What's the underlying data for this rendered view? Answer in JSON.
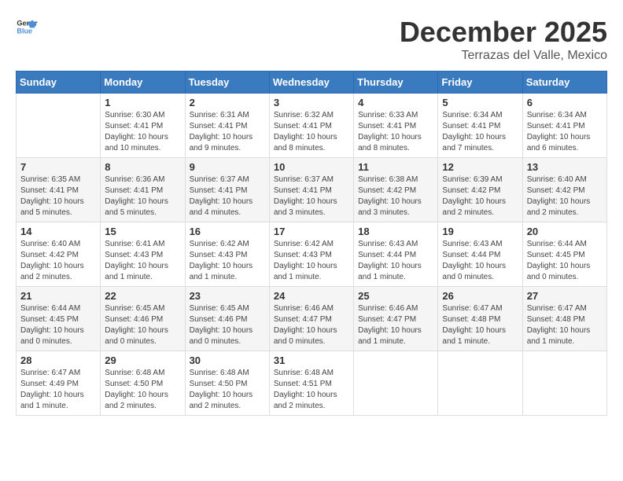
{
  "logo": {
    "text_general": "General",
    "text_blue": "Blue"
  },
  "title": {
    "month": "December 2025",
    "location": "Terrazas del Valle, Mexico"
  },
  "weekdays": [
    "Sunday",
    "Monday",
    "Tuesday",
    "Wednesday",
    "Thursday",
    "Friday",
    "Saturday"
  ],
  "weeks": [
    [
      {
        "day": "",
        "info": ""
      },
      {
        "day": "1",
        "info": "Sunrise: 6:30 AM\nSunset: 4:41 PM\nDaylight: 10 hours\nand 10 minutes."
      },
      {
        "day": "2",
        "info": "Sunrise: 6:31 AM\nSunset: 4:41 PM\nDaylight: 10 hours\nand 9 minutes."
      },
      {
        "day": "3",
        "info": "Sunrise: 6:32 AM\nSunset: 4:41 PM\nDaylight: 10 hours\nand 8 minutes."
      },
      {
        "day": "4",
        "info": "Sunrise: 6:33 AM\nSunset: 4:41 PM\nDaylight: 10 hours\nand 8 minutes."
      },
      {
        "day": "5",
        "info": "Sunrise: 6:34 AM\nSunset: 4:41 PM\nDaylight: 10 hours\nand 7 minutes."
      },
      {
        "day": "6",
        "info": "Sunrise: 6:34 AM\nSunset: 4:41 PM\nDaylight: 10 hours\nand 6 minutes."
      }
    ],
    [
      {
        "day": "7",
        "info": "Sunrise: 6:35 AM\nSunset: 4:41 PM\nDaylight: 10 hours\nand 5 minutes."
      },
      {
        "day": "8",
        "info": "Sunrise: 6:36 AM\nSunset: 4:41 PM\nDaylight: 10 hours\nand 5 minutes."
      },
      {
        "day": "9",
        "info": "Sunrise: 6:37 AM\nSunset: 4:41 PM\nDaylight: 10 hours\nand 4 minutes."
      },
      {
        "day": "10",
        "info": "Sunrise: 6:37 AM\nSunset: 4:41 PM\nDaylight: 10 hours\nand 3 minutes."
      },
      {
        "day": "11",
        "info": "Sunrise: 6:38 AM\nSunset: 4:42 PM\nDaylight: 10 hours\nand 3 minutes."
      },
      {
        "day": "12",
        "info": "Sunrise: 6:39 AM\nSunset: 4:42 PM\nDaylight: 10 hours\nand 2 minutes."
      },
      {
        "day": "13",
        "info": "Sunrise: 6:40 AM\nSunset: 4:42 PM\nDaylight: 10 hours\nand 2 minutes."
      }
    ],
    [
      {
        "day": "14",
        "info": "Sunrise: 6:40 AM\nSunset: 4:42 PM\nDaylight: 10 hours\nand 2 minutes."
      },
      {
        "day": "15",
        "info": "Sunrise: 6:41 AM\nSunset: 4:43 PM\nDaylight: 10 hours\nand 1 minute."
      },
      {
        "day": "16",
        "info": "Sunrise: 6:42 AM\nSunset: 4:43 PM\nDaylight: 10 hours\nand 1 minute."
      },
      {
        "day": "17",
        "info": "Sunrise: 6:42 AM\nSunset: 4:43 PM\nDaylight: 10 hours\nand 1 minute."
      },
      {
        "day": "18",
        "info": "Sunrise: 6:43 AM\nSunset: 4:44 PM\nDaylight: 10 hours\nand 1 minute."
      },
      {
        "day": "19",
        "info": "Sunrise: 6:43 AM\nSunset: 4:44 PM\nDaylight: 10 hours\nand 0 minutes."
      },
      {
        "day": "20",
        "info": "Sunrise: 6:44 AM\nSunset: 4:45 PM\nDaylight: 10 hours\nand 0 minutes."
      }
    ],
    [
      {
        "day": "21",
        "info": "Sunrise: 6:44 AM\nSunset: 4:45 PM\nDaylight: 10 hours\nand 0 minutes."
      },
      {
        "day": "22",
        "info": "Sunrise: 6:45 AM\nSunset: 4:46 PM\nDaylight: 10 hours\nand 0 minutes."
      },
      {
        "day": "23",
        "info": "Sunrise: 6:45 AM\nSunset: 4:46 PM\nDaylight: 10 hours\nand 0 minutes."
      },
      {
        "day": "24",
        "info": "Sunrise: 6:46 AM\nSunset: 4:47 PM\nDaylight: 10 hours\nand 0 minutes."
      },
      {
        "day": "25",
        "info": "Sunrise: 6:46 AM\nSunset: 4:47 PM\nDaylight: 10 hours\nand 1 minute."
      },
      {
        "day": "26",
        "info": "Sunrise: 6:47 AM\nSunset: 4:48 PM\nDaylight: 10 hours\nand 1 minute."
      },
      {
        "day": "27",
        "info": "Sunrise: 6:47 AM\nSunset: 4:48 PM\nDaylight: 10 hours\nand 1 minute."
      }
    ],
    [
      {
        "day": "28",
        "info": "Sunrise: 6:47 AM\nSunset: 4:49 PM\nDaylight: 10 hours\nand 1 minute."
      },
      {
        "day": "29",
        "info": "Sunrise: 6:48 AM\nSunset: 4:50 PM\nDaylight: 10 hours\nand 2 minutes."
      },
      {
        "day": "30",
        "info": "Sunrise: 6:48 AM\nSunset: 4:50 PM\nDaylight: 10 hours\nand 2 minutes."
      },
      {
        "day": "31",
        "info": "Sunrise: 6:48 AM\nSunset: 4:51 PM\nDaylight: 10 hours\nand 2 minutes."
      },
      {
        "day": "",
        "info": ""
      },
      {
        "day": "",
        "info": ""
      },
      {
        "day": "",
        "info": ""
      }
    ]
  ]
}
